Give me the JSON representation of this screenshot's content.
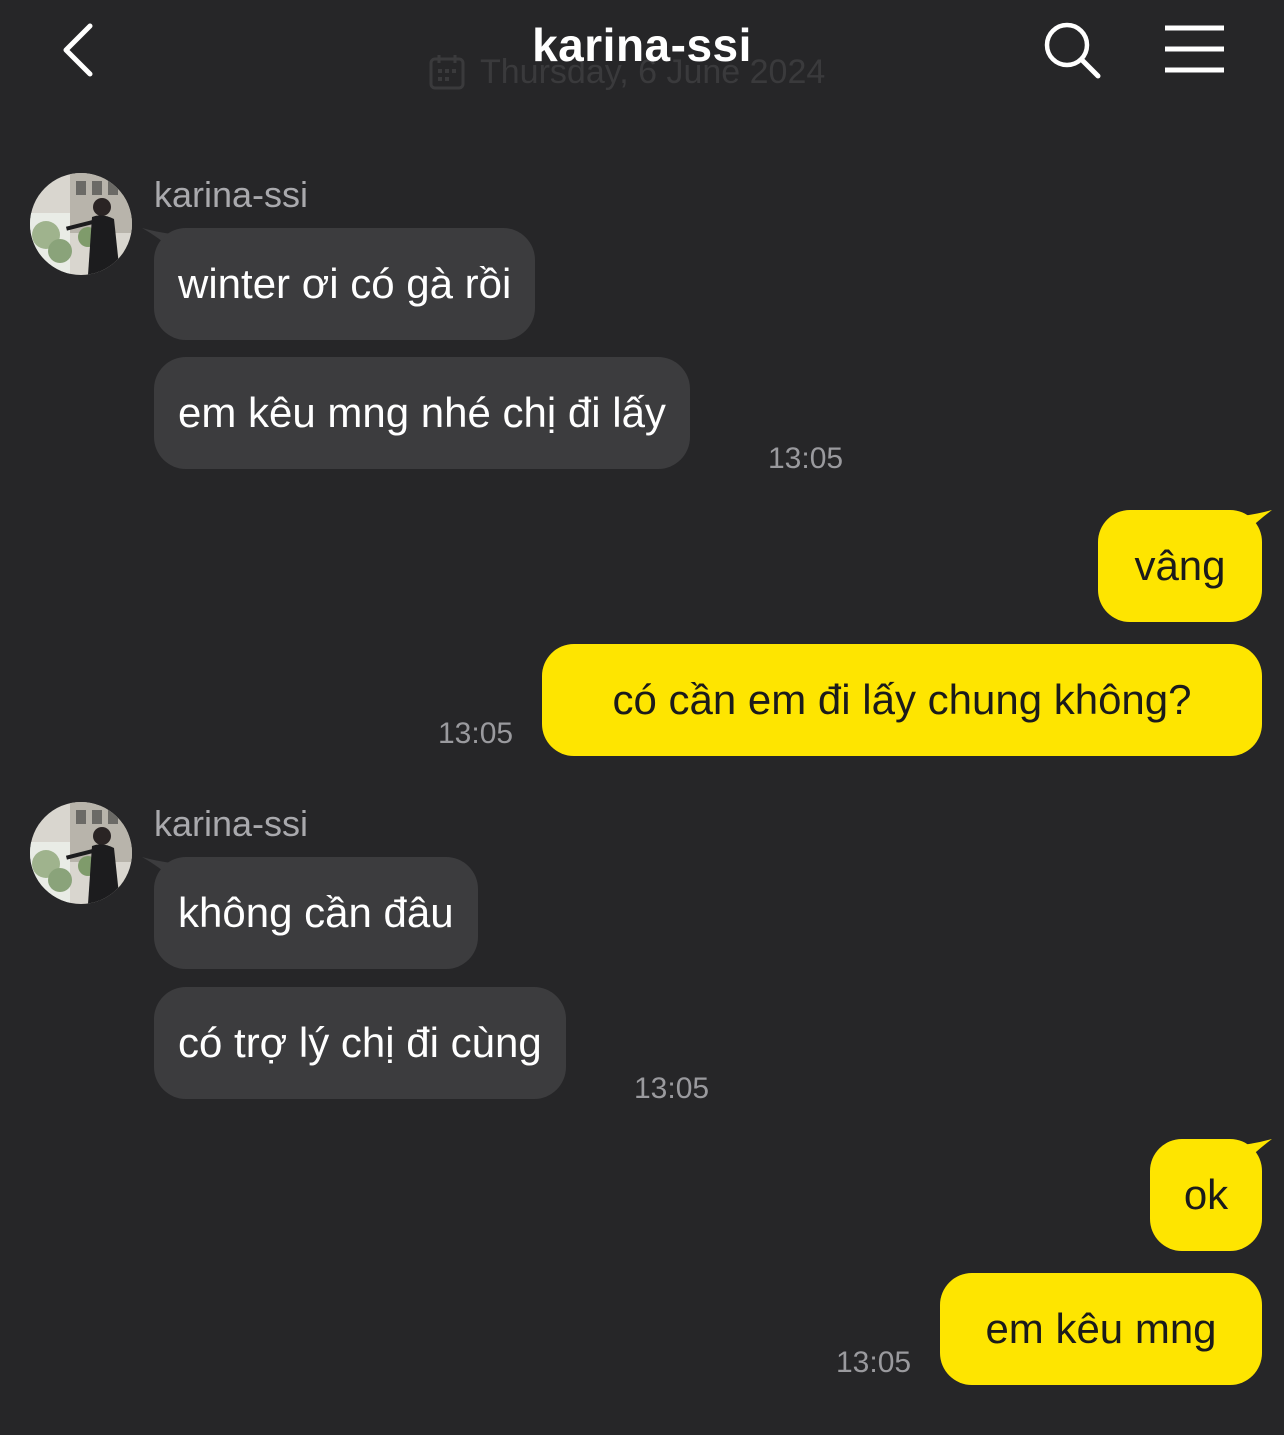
{
  "header": {
    "title": "karina-ssi",
    "date_overlay": "Thursday, 6 June 2024",
    "back_icon": "chevron-left-icon",
    "search_icon": "search-icon",
    "menu_icon": "hamburger-menu-icon"
  },
  "colors": {
    "background": "#262628",
    "incoming_bubble": "#3c3c3e",
    "outgoing_bubble": "#fee500"
  },
  "messages": [
    {
      "sender": "karina-ssi",
      "direction": "incoming",
      "texts": [
        "winter ơi có gà rồi",
        "em kêu mng nhé chị đi lấy"
      ],
      "time": "13:05"
    },
    {
      "sender": "me",
      "direction": "outgoing",
      "texts": [
        "vâng",
        "có cần em đi lấy chung không?"
      ],
      "time": "13:05"
    },
    {
      "sender": "karina-ssi",
      "direction": "incoming",
      "texts": [
        "không cần đâu",
        "có trợ lý chị đi cùng"
      ],
      "time": "13:05"
    },
    {
      "sender": "me",
      "direction": "outgoing",
      "texts": [
        "ok",
        "em kêu mng"
      ],
      "time": "13:05"
    }
  ]
}
